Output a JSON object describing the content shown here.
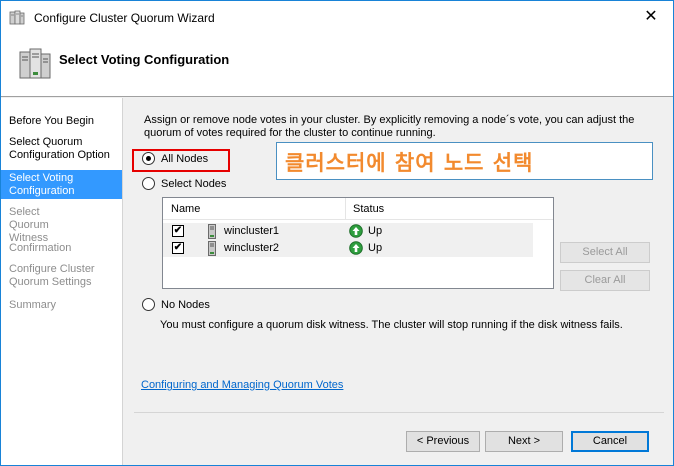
{
  "window": {
    "title": "Configure Cluster Quorum Wizard",
    "close_glyph": "✕"
  },
  "header": {
    "title": "Select Voting Configuration"
  },
  "sidebar": {
    "items": [
      {
        "label": "Before You Begin",
        "state": "normal"
      },
      {
        "label": "Select Quorum Configuration Option",
        "state": "normal"
      },
      {
        "label": "Select Voting Configuration",
        "state": "active"
      },
      {
        "label": "Select Quorum Witness",
        "state": "disabled"
      },
      {
        "label": "Confirmation",
        "state": "disabled"
      },
      {
        "label": "Configure Cluster Quorum Settings",
        "state": "disabled"
      },
      {
        "label": "Summary",
        "state": "disabled"
      }
    ]
  },
  "main": {
    "intro": "Assign or remove node votes in your cluster. By explicitly removing a node´s vote, you can adjust the quorum of votes required for the cluster to continue running.",
    "options": {
      "all_nodes": "All Nodes",
      "select_nodes": "Select Nodes",
      "no_nodes": "No Nodes",
      "selected": "all_nodes"
    },
    "table": {
      "columns": [
        "Name",
        "Status"
      ],
      "rows": [
        {
          "name": "wincluster1",
          "status": "Up",
          "checked": true
        },
        {
          "name": "wincluster2",
          "status": "Up",
          "checked": true
        }
      ]
    },
    "select_all_label": "Select All",
    "clear_all_label": "Clear All",
    "no_nodes_note": "You must configure a quorum disk witness. The cluster will stop running if the disk witness fails.",
    "help_link": "Configuring and Managing Quorum Votes"
  },
  "annotation": {
    "callout_text": "클러스터에 참여 노드 선택",
    "highlight_color": "#e60000",
    "callout_text_color": "#f28a2e"
  },
  "footer": {
    "previous_label": "< Previous",
    "next_label": "Next >",
    "cancel_label": "Cancel"
  },
  "colors": {
    "accent": "#3399ff",
    "link": "#0066cc",
    "status_up": "#2e9e3e"
  }
}
